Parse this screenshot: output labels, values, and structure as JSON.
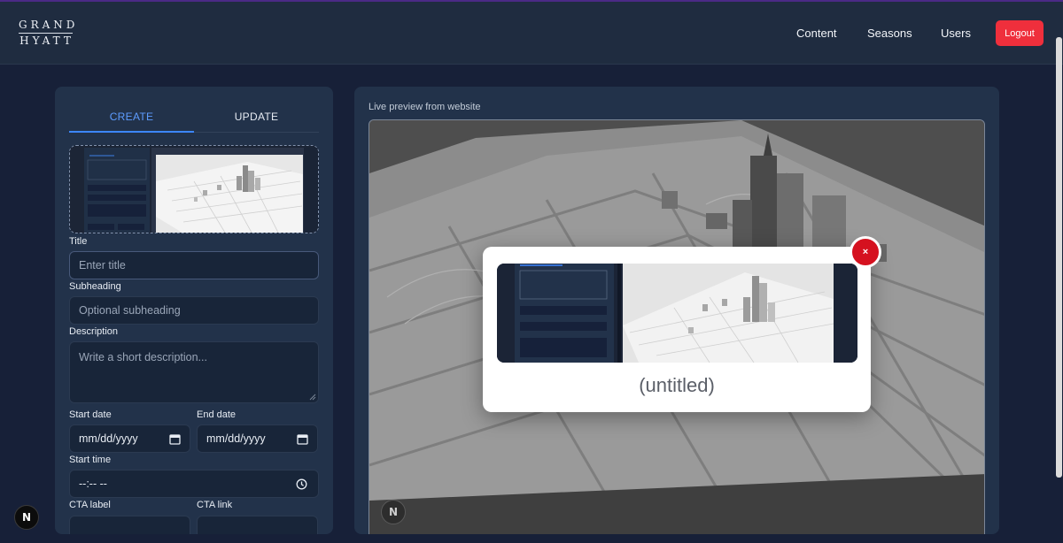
{
  "brand": {
    "line1": "GRAND",
    "line2": "HYATT"
  },
  "nav": {
    "content": "Content",
    "seasons": "Seasons",
    "users": "Users",
    "logout": "Logout"
  },
  "tabs": {
    "create": "CREATE",
    "update": "UPDATE"
  },
  "form": {
    "title_label": "Title",
    "title_placeholder": "Enter title",
    "subheading_label": "Subheading",
    "subheading_placeholder": "Optional subheading",
    "description_label": "Description",
    "description_placeholder": "Write a short description...",
    "start_date_label": "Start date",
    "start_date_placeholder": "mm/dd/yyyy",
    "end_date_label": "End date",
    "end_date_placeholder": "mm/dd/yyyy",
    "start_time_label": "Start time",
    "start_time_placeholder": "--:-- --",
    "cta_label_label": "CTA label",
    "cta_link_label": "CTA link"
  },
  "preview": {
    "title": "Live preview from website"
  },
  "modal": {
    "title": "(untitled)",
    "close": "×"
  },
  "badge": {
    "letter": "N"
  },
  "colors": {
    "accent": "#3c86ff",
    "danger": "#ef2f3c",
    "panel": "#22324a",
    "background": "#172038"
  }
}
